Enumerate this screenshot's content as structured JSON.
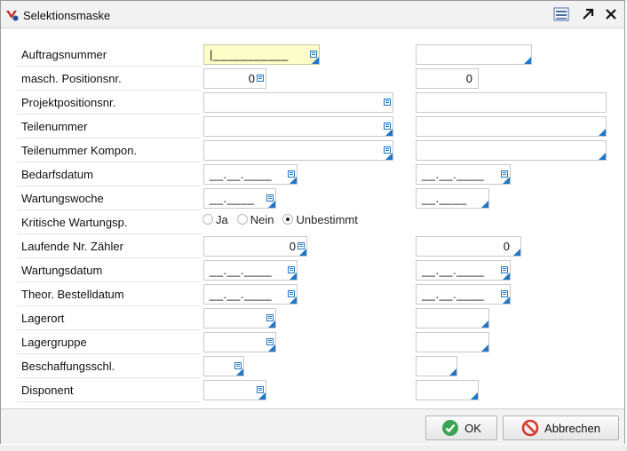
{
  "window": {
    "title": "Selektionsmaske"
  },
  "icons": {
    "app": "app-logo-icon",
    "menu": "window-menu-icon",
    "maximize": "arrow-up-right-icon",
    "close": "close-icon",
    "field_menu": "field-menu-icon",
    "ok": "check-circle-icon",
    "cancel": "prohibited-icon"
  },
  "colors": {
    "accent": "#1f77c5",
    "highlight_field": "#fdfdc8",
    "ok_green": "#3aa556",
    "cancel_red": "#d63a2a"
  },
  "rows": [
    {
      "label": "Auftragsnummer",
      "from": "|___________",
      "to": ""
    },
    {
      "label": "masch. Positionsnr.",
      "from": "0",
      "to": "0"
    },
    {
      "label": "Projektpositionsnr.",
      "from": "",
      "to": ""
    },
    {
      "label": "Teilenummer",
      "from": "",
      "to": ""
    },
    {
      "label": "Teilenummer Kompon.",
      "from": "",
      "to": ""
    },
    {
      "label": "Bedarfsdatum",
      "from": "__.__.____",
      "to": "__.__.____"
    },
    {
      "label": "Wartungswoche",
      "from": "__.____",
      "to": "__.____"
    },
    {
      "label": "Kritische Wartungsp.",
      "options": [
        "Ja",
        "Nein",
        "Unbestimmt"
      ],
      "selected": "Unbestimmt"
    },
    {
      "label": "Laufende Nr. Zähler",
      "from": "0",
      "to": "0"
    },
    {
      "label": "Wartungsdatum",
      "from": "__.__.____",
      "to": "__.__.____"
    },
    {
      "label": "Theor. Bestelldatum",
      "from": "__.__.____",
      "to": "__.__.____"
    },
    {
      "label": "Lagerort",
      "from": "",
      "to": ""
    },
    {
      "label": "Lagergruppe",
      "from": "",
      "to": ""
    },
    {
      "label": "Beschaffungsschl.",
      "from": "",
      "to": ""
    },
    {
      "label": "Disponent",
      "from": "",
      "to": ""
    }
  ],
  "buttons": {
    "ok": "OK",
    "cancel": "Abbrechen"
  }
}
